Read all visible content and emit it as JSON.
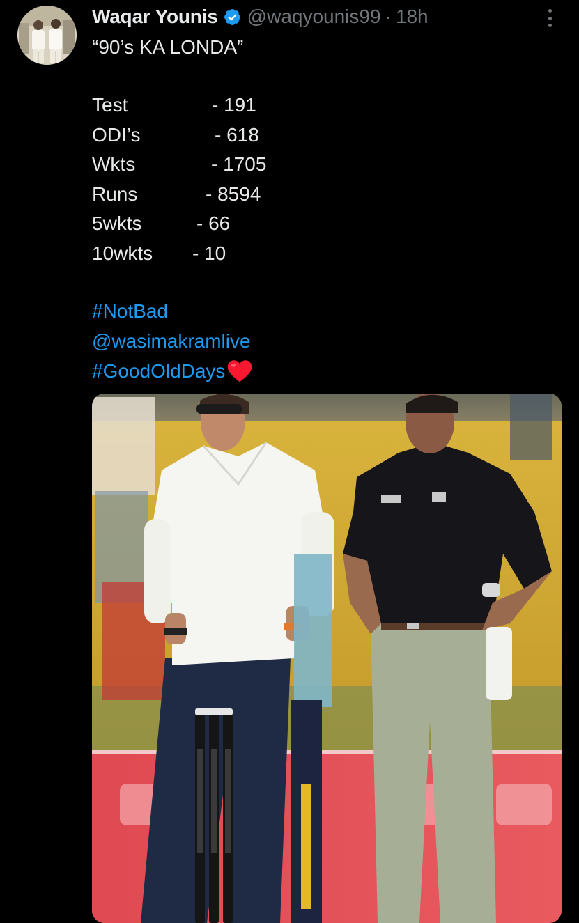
{
  "tweet": {
    "author": {
      "name": "Waqar Younis",
      "handle": "@waqyounis99",
      "verified": true,
      "avatar_icon": "avatar-photo"
    },
    "separator": "·",
    "time": "18h",
    "more_icon": "more-vertical-icon",
    "headline": "“90’s KA LONDA”",
    "stats": [
      {
        "label": "Test",
        "value": "- 191"
      },
      {
        "label": "ODI’s",
        "value": "- 618"
      },
      {
        "label": "Wkts",
        "value": "- 1705"
      },
      {
        "label": "Runs",
        "value": "- 8594"
      },
      {
        "label": "5wkts",
        "value": "- 66"
      },
      {
        "label": "10wkts",
        "value": "- 10"
      }
    ],
    "links": [
      {
        "text": "#NotBad",
        "type": "hashtag"
      },
      {
        "text": "@wasimakramlive",
        "type": "mention"
      },
      {
        "text": "#GoodOldDays",
        "type": "hashtag",
        "emoji": "heart-emoji"
      }
    ],
    "media": {
      "type": "photo"
    }
  },
  "colors": {
    "background": "#000000",
    "text_primary": "#e7e9ea",
    "text_secondary": "#71767b",
    "link": "#1d9bf0",
    "verified": "#1d9bf0",
    "heart": "#f91880"
  }
}
